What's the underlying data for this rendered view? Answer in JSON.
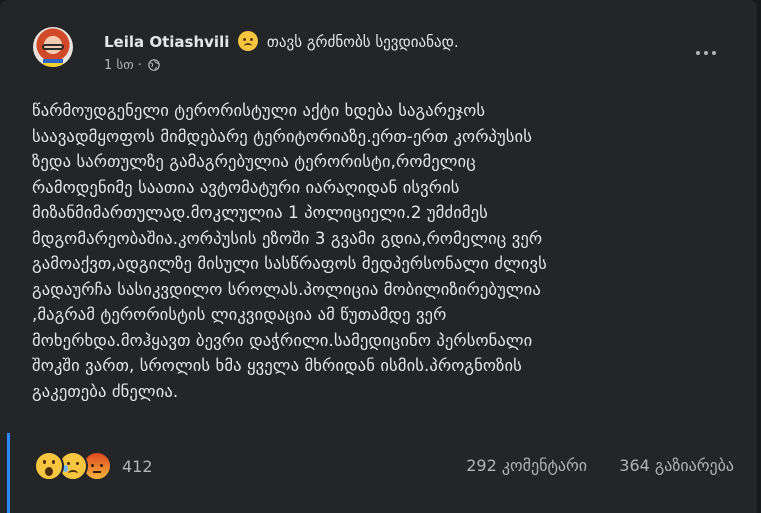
{
  "post": {
    "author": "Leila Otiashvili",
    "feeling_icon": "sad-face-emoji",
    "feeling_text": "თავს გრძნობს სევდიანად.",
    "timestamp": "1 სთ",
    "separator": "·",
    "privacy_icon": "globe-icon",
    "text": "წარმოუდგენელი ტერორისტული აქტი ხდება საგარეჯოს\nსაავადმყოფოს მიმდებარე ტერიტორიაზე.ერთ-ერთ კორპუსის\nზედა სართულზე გამაგრებულია ტერორისტი,რომელიც\nრამოდენიმე საათია ავტომატური იარაღიდან ისვრის\nმიზანმიმართულად.მოკლულია 1 პოლიციელი.2 უმძიმეს\nმდგომარეობაშია.კორპუსის ეზოში 3 გვამი გდია,რომელიც ვერ\nგამოაქვთ,ადგილზე მისული სასწრაფოს მედპერსონალი ძლივს\nგადაურჩა სასიკვდილო სროლას.პოლიცია მობილიზირებულია\n,მაგრამ ტერორისტის ლიკვიდაცია ამ წუთამდე ვერ\nმოხერხდა.მოჰყავთ ბევრი დაჭრილი.სამედიცინო პერსონალი\nშოკში ვართ, სროლის ხმა ყველა მხრიდან ისმის.პროგნოზის\nგაკეთება ძნელია."
  },
  "reactions": {
    "icons": [
      "wow-reaction-icon",
      "sad-reaction-icon",
      "angry-reaction-icon"
    ],
    "count": "412"
  },
  "stats": {
    "comments": "292 კომენტარი",
    "shares": "364 გაზიარება"
  },
  "colors": {
    "background": "#18191a",
    "card": "#242526",
    "primary_text": "#e4e6eb",
    "secondary_text": "#b0b3b8",
    "focus_accent": "#2d88ff"
  }
}
